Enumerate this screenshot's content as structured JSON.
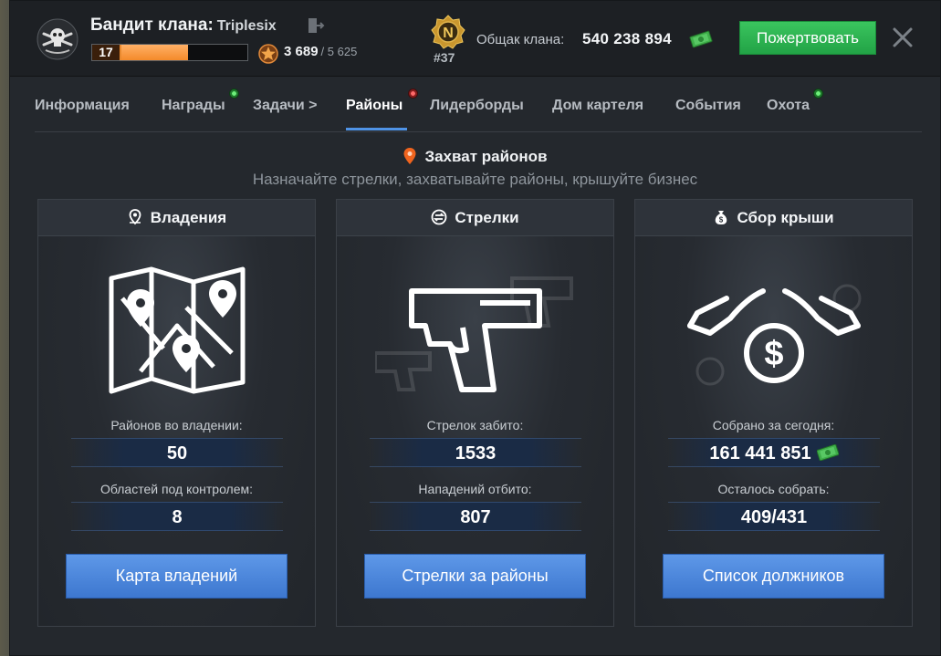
{
  "header": {
    "clan_label": "Бандит клана:",
    "clan_name": "Triplesix",
    "level": "17",
    "level_progress": 0.62,
    "reputation": "3 689",
    "reputation_max": "/ 5 625",
    "rank_letter": "N",
    "rank": "#37",
    "treasury_label": "Общак клана:",
    "treasury_value": "540 238 894",
    "donate_label": "Пожертвовать",
    "icons": [
      "clan-emblem",
      "exit-icon",
      "reputation-star-icon",
      "rank-badge-icon",
      "money-icon",
      "close-icon"
    ]
  },
  "tabs": [
    {
      "label": "Информация",
      "active": false,
      "dot": null
    },
    {
      "label": "Награды",
      "active": false,
      "dot": "green"
    },
    {
      "label": "Задачи >",
      "active": false,
      "dot": null
    },
    {
      "label": "Районы",
      "active": true,
      "dot": "red"
    },
    {
      "label": "Лидерборды",
      "active": false,
      "dot": null
    },
    {
      "label": "Дом картеля",
      "active": false,
      "dot": null
    },
    {
      "label": "События",
      "active": false,
      "dot": null
    },
    {
      "label": "Охота",
      "active": false,
      "dot": "green"
    }
  ],
  "section": {
    "title": "Захват районов",
    "subtitle": "Назначайте стрелки, захватывайте районы, крышуйте бизнес"
  },
  "cards": [
    {
      "title": "Владения",
      "icon": "location-pin-icon",
      "art": "map-icon",
      "stat1_label": "Районов во владении:",
      "stat1_value": "50",
      "stat2_label": "Областей под контролем:",
      "stat2_value": "8",
      "button": "Карта владений"
    },
    {
      "title": "Стрелки",
      "icon": "swap-arrows-icon",
      "art": "pistol-icon",
      "stat1_label": "Стрелок забито:",
      "stat1_value": "1533",
      "stat2_label": "Нападений отбито:",
      "stat2_value": "807",
      "button": "Стрелки за районы"
    },
    {
      "title": "Сбор крыши",
      "icon": "money-bag-icon",
      "art": "protection-money-icon",
      "stat1_label": "Собрано за сегодня:",
      "stat1_value": "161 441 851",
      "stat2_label": "Осталось собрать:",
      "stat2_value": "409/431",
      "button": "Список должников"
    }
  ],
  "colors": {
    "accent_blue": "#4f93e6",
    "donate_green": "#2db552",
    "level_orange": "#f48a2a"
  }
}
